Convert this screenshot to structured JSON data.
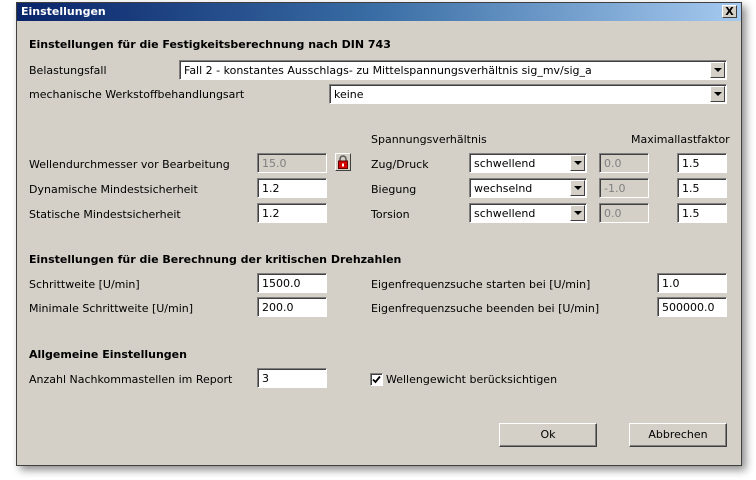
{
  "window": {
    "title": "Einstellungen",
    "close_label": "X"
  },
  "section1": {
    "header": "Einstellungen für die Festigkeitsberechnung nach DIN 743",
    "belastungsfall_label": "Belastungsfall",
    "belastungsfall_value": "Fall 2 - konstantes Ausschlags- zu Mittelspannungsverhältnis sig_mv/sig_a",
    "behandlung_label": "mechanische Werkstoffbehandlungsart",
    "behandlung_value": "keine",
    "spannung_header": "Spannungsverhältnis",
    "max_header": "Maximallastfaktor",
    "wellen_label": "Wellendurchmesser vor Bearbeitung",
    "wellen_value": "15.0",
    "dyn_label": "Dynamische Mindestsicherheit",
    "dyn_value": "1.2",
    "stat_label": "Statische Mindestsicherheit",
    "stat_value": "1.2",
    "rows": [
      {
        "label": "Zug/Druck",
        "mode": "schwellend",
        "ratio": "0.0",
        "factor": "1.5"
      },
      {
        "label": "Biegung",
        "mode": "wechselnd",
        "ratio": "-1.0",
        "factor": "1.5"
      },
      {
        "label": "Torsion",
        "mode": "schwellend",
        "ratio": "0.0",
        "factor": "1.5"
      }
    ]
  },
  "section2": {
    "header": "Einstellungen für die Berechnung der kritischen Drehzahlen",
    "schritt_label": "Schrittweite [U/min]",
    "schritt_value": "1500.0",
    "minschritt_label": "Minimale Schrittweite [U/min]",
    "minschritt_value": "200.0",
    "start_label": "Eigenfrequenzsuche starten bei [U/min]",
    "start_value": "1.0",
    "end_label": "Eigenfrequenzsuche beenden bei [U/min]",
    "end_value": "500000.0"
  },
  "section3": {
    "header": "Allgemeine Einstellungen",
    "nachkomma_label": "Anzahl Nachkommastellen im Report",
    "nachkomma_value": "3",
    "gewicht_label": "Wellengewicht berücksichtigen",
    "gewicht_checked": true
  },
  "buttons": {
    "ok": "Ok",
    "cancel": "Abbrechen"
  }
}
